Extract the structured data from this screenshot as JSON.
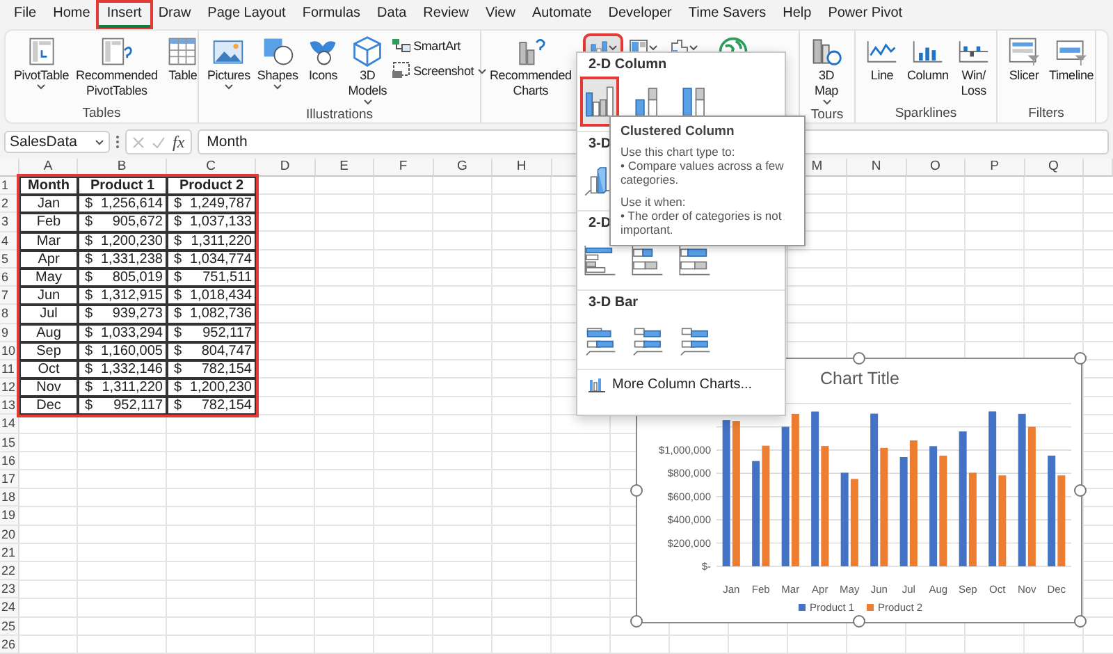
{
  "menu_tabs": [
    {
      "label": "File",
      "selected": false,
      "annotated": false
    },
    {
      "label": "Home",
      "selected": false,
      "annotated": false
    },
    {
      "label": "Insert",
      "selected": true,
      "annotated": true
    },
    {
      "label": "Draw",
      "selected": false,
      "annotated": false
    },
    {
      "label": "Page Layout",
      "selected": false,
      "annotated": false
    },
    {
      "label": "Formulas",
      "selected": false,
      "annotated": false
    },
    {
      "label": "Data",
      "selected": false,
      "annotated": false
    },
    {
      "label": "Review",
      "selected": false,
      "annotated": false
    },
    {
      "label": "View",
      "selected": false,
      "annotated": false
    },
    {
      "label": "Automate",
      "selected": false,
      "annotated": false
    },
    {
      "label": "Developer",
      "selected": false,
      "annotated": false
    },
    {
      "label": "Time Savers",
      "selected": false,
      "annotated": false
    },
    {
      "label": "Help",
      "selected": false,
      "annotated": false
    },
    {
      "label": "Power Pivot",
      "selected": false,
      "annotated": false
    }
  ],
  "ribbon": {
    "groups": [
      {
        "label": "Tables",
        "items": [
          {
            "kind": "large",
            "label": "PivotTable",
            "dropdown": true
          },
          {
            "kind": "large",
            "label": "Recommended PivotTables",
            "dropdown": false
          },
          {
            "kind": "large",
            "label": "Table",
            "dropdown": false
          }
        ]
      },
      {
        "label": "Illustrations",
        "items": [
          {
            "kind": "large",
            "label": "Pictures",
            "dropdown": true
          },
          {
            "kind": "large",
            "label": "Shapes",
            "dropdown": true
          },
          {
            "kind": "large",
            "label": "Icons",
            "dropdown": false
          },
          {
            "kind": "large",
            "label": "3D Models",
            "dropdown": true
          },
          {
            "kind": "small",
            "label": "SmartArt",
            "dropdown": false
          },
          {
            "kind": "small",
            "label": "Screenshot",
            "dropdown": true
          }
        ]
      },
      {
        "items": [
          {
            "kind": "large",
            "label": "Recommended Charts",
            "dropdown": false
          },
          {
            "kind": "chart",
            "dropdown": true,
            "pressed": true,
            "annotated": true
          },
          {
            "kind": "chart",
            "dropdown": true,
            "pressed": false,
            "annotated": false
          },
          {
            "kind": "chart",
            "dropdown": true,
            "pressed": false,
            "annotated": false
          },
          {
            "kind": "icon"
          }
        ]
      },
      {
        "label": "Tours",
        "items": [
          {
            "kind": "large",
            "label": "3D Map",
            "dropdown": true
          }
        ]
      },
      {
        "label": "Sparklines",
        "items": [
          {
            "kind": "large",
            "label": "Line",
            "dropdown": false
          },
          {
            "kind": "large",
            "label": "Column",
            "dropdown": false
          },
          {
            "kind": "large",
            "label": "Win/ Loss",
            "dropdown": false
          }
        ]
      },
      {
        "label": "Filters",
        "items": [
          {
            "kind": "large",
            "label": "Slicer",
            "dropdown": false
          },
          {
            "kind": "large",
            "label": "Timeline",
            "dropdown": false
          }
        ]
      }
    ]
  },
  "formula_bar": {
    "name_box": "SalesData",
    "function_label": "fx",
    "value": "Month"
  },
  "sheet": {
    "columns_left": [
      "A",
      "B",
      "C",
      "D",
      "E",
      "F",
      "G",
      "H"
    ],
    "columns_right": [
      "M",
      "N",
      "O",
      "P",
      "Q"
    ],
    "rows": [
      "1",
      "2",
      "3",
      "4",
      "5",
      "6",
      "7",
      "8",
      "9",
      "10",
      "11",
      "12",
      "13",
      "14",
      "15",
      "16",
      "17",
      "18",
      "19",
      "20",
      "21",
      "22",
      "23",
      "24",
      "25",
      "26"
    ],
    "table": {
      "annotated": true,
      "header": [
        "Month",
        "Product 1",
        "Product 2"
      ],
      "rows": [
        {
          "month": "Jan",
          "product_1": {
            "currency": "$",
            "amount": "1,256,614"
          },
          "product_2": {
            "currency": "$",
            "amount": "1,249,787"
          }
        },
        {
          "month": "Feb",
          "product_1": {
            "currency": "$",
            "amount": "905,672"
          },
          "product_2": {
            "currency": "$",
            "amount": "1,037,133"
          }
        },
        {
          "month": "Mar",
          "product_1": {
            "currency": "$",
            "amount": "1,200,230"
          },
          "product_2": {
            "currency": "$",
            "amount": "1,311,220"
          }
        },
        {
          "month": "Apr",
          "product_1": {
            "currency": "$",
            "amount": "1,331,238"
          },
          "product_2": {
            "currency": "$",
            "amount": "1,034,774"
          }
        },
        {
          "month": "May",
          "product_1": {
            "currency": "$",
            "amount": "805,019"
          },
          "product_2": {
            "currency": "$",
            "amount": "751,511"
          }
        },
        {
          "month": "Jun",
          "product_1": {
            "currency": "$",
            "amount": "1,312,915"
          },
          "product_2": {
            "currency": "$",
            "amount": "1,018,434"
          }
        },
        {
          "month": "Jul",
          "product_1": {
            "currency": "$",
            "amount": "939,273"
          },
          "product_2": {
            "currency": "$",
            "amount": "1,082,736"
          }
        },
        {
          "month": "Aug",
          "product_1": {
            "currency": "$",
            "amount": "1,033,294"
          },
          "product_2": {
            "currency": "$",
            "amount": "952,117"
          }
        },
        {
          "month": "Sep",
          "product_1": {
            "currency": "$",
            "amount": "1,160,005"
          },
          "product_2": {
            "currency": "$",
            "amount": "804,747"
          }
        },
        {
          "month": "Oct",
          "product_1": {
            "currency": "$",
            "amount": "1,332,146"
          },
          "product_2": {
            "currency": "$",
            "amount": "782,154"
          }
        },
        {
          "month": "Nov",
          "product_1": {
            "currency": "$",
            "amount": "1,311,220"
          },
          "product_2": {
            "currency": "$",
            "amount": "1,200,230"
          }
        },
        {
          "month": "Dec",
          "product_1": {
            "currency": "$",
            "amount": "952,117"
          },
          "product_2": {
            "currency": "$",
            "amount": "782,154"
          }
        }
      ]
    }
  },
  "chart": {
    "selected": true,
    "chart_data": {
      "type": "bar",
      "title": "Chart Title",
      "categories": [
        "Jan",
        "Feb",
        "Mar",
        "Apr",
        "May",
        "Jun",
        "Jul",
        "Aug",
        "Sep",
        "Oct",
        "Nov",
        "Dec"
      ],
      "series": [
        {
          "name": "Product 1",
          "color": "#4472c4",
          "values": [
            1256614,
            905672,
            1200230,
            1331238,
            805019,
            1312915,
            939273,
            1033294,
            1160005,
            1332146,
            1311220,
            952117
          ]
        },
        {
          "name": "Product 2",
          "color": "#ed7d31",
          "values": [
            1249787,
            1037133,
            1311220,
            1034774,
            751511,
            1018434,
            1082736,
            952117,
            804747,
            782154,
            1200230,
            782154
          ]
        }
      ],
      "ylim": [
        0,
        1400000
      ],
      "grid": true,
      "legend": true,
      "yticks": [
        {
          "value": 0,
          "label": "$-"
        },
        {
          "value": 200000,
          "label": "$200,000"
        },
        {
          "value": 400000,
          "label": "$400,000"
        },
        {
          "value": 600000,
          "label": "$600,000"
        },
        {
          "value": 800000,
          "label": "$800,000"
        },
        {
          "value": 1000000,
          "label": "$1,000,000"
        }
      ]
    }
  },
  "dropdown_menu": {
    "sections": [
      {
        "title": "2-D Column",
        "kind": "column2d",
        "options": [
          {
            "selected": true,
            "annotated": true
          },
          {
            "selected": false,
            "annotated": false
          },
          {
            "selected": false,
            "annotated": false
          }
        ]
      },
      {
        "title": "3-D",
        "kind": "column3d",
        "options": [
          {
            "selected": false,
            "annotated": false
          }
        ]
      },
      {
        "title": "2-D",
        "kind": "bar2d",
        "options": [
          {
            "selected": false,
            "annotated": false
          },
          {
            "selected": false,
            "annotated": false
          },
          {
            "selected": false,
            "annotated": false
          }
        ]
      },
      {
        "title": "3-D Bar",
        "kind": "bar3d",
        "options": [
          {
            "selected": false,
            "annotated": false
          },
          {
            "selected": false,
            "annotated": false
          },
          {
            "selected": false,
            "annotated": false
          }
        ]
      }
    ],
    "footer": "More Column Charts..."
  },
  "tooltip": {
    "title": "Clustered Column",
    "sections": [
      {
        "heading": "Use this chart type to:",
        "bullet": "• Compare values across a few categories."
      },
      {
        "heading": "Use it when:",
        "bullet": "• The order of categories is not important."
      }
    ]
  }
}
